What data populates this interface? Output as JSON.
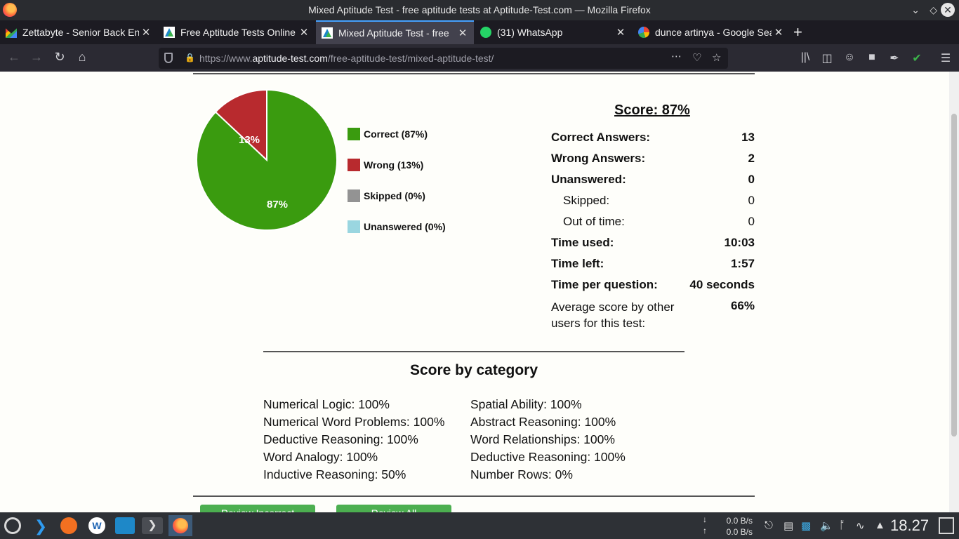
{
  "window": {
    "title": "Mixed Aptitude Test - free aptitude tests at Aptitude-Test.com — Mozilla Firefox"
  },
  "tabs": [
    {
      "label": "Zettabyte - Senior Back En",
      "icon": "gmail-icon"
    },
    {
      "label": "Free Aptitude Tests Online",
      "icon": "aptitude-test-icon"
    },
    {
      "label": "Mixed Aptitude Test - free",
      "icon": "aptitude-test-icon",
      "active": true
    },
    {
      "label": "(31) WhatsApp",
      "icon": "whatsapp-icon"
    },
    {
      "label": "dunce artinya - Google Sea",
      "icon": "google-icon"
    }
  ],
  "nav": {
    "url_prefix": "https://www.",
    "url_host": "aptitude-test.com",
    "url_path": "/free-aptitude-test/mixed-aptitude-test/"
  },
  "pie": {
    "correct_label": "87%",
    "wrong_label": "13%",
    "correct_fraction": 0.87,
    "wrong_fraction": 0.13
  },
  "legend": [
    {
      "label": "Correct (87%)",
      "color": "#3a9b0f"
    },
    {
      "label": "Wrong (13%)",
      "color": "#b82a2e"
    },
    {
      "label": "Skipped (0%)",
      "color": "#939393"
    },
    {
      "label": "Unanswered (0%)",
      "color": "#9ad6e0"
    }
  ],
  "score": {
    "title": "Score: 87%",
    "rows": [
      {
        "label": "Correct Answers:",
        "value": "13"
      },
      {
        "label": "Wrong Answers:",
        "value": "2"
      },
      {
        "label": "Unanswered:",
        "value": "0"
      },
      {
        "label": "Skipped:",
        "value": "0"
      },
      {
        "label": "Out of time:",
        "value": "0"
      },
      {
        "label": "Time used:",
        "value": "10:03"
      },
      {
        "label": "Time left:",
        "value": "1:57"
      },
      {
        "label": "Time per question:",
        "value": "40 seconds"
      }
    ],
    "average_label_line1": "Average score by other",
    "average_label_line2": "users for this test:",
    "average_value": "66%"
  },
  "categories": {
    "title": "Score by category",
    "left": [
      "Numerical Logic: 100%",
      "Numerical Word Problems: 100%",
      "Deductive Reasoning: 100%",
      "Word Analogy: 100%",
      "Inductive Reasoning: 50%"
    ],
    "right": [
      "Spatial Ability: 100%",
      "Abstract Reasoning: 100%",
      "Word Relationships: 100%",
      "Deductive Reasoning: 100%",
      "Number Rows: 0%"
    ]
  },
  "buttons": {
    "review_incorrect": "Review Incorrect",
    "review_all": "Review All"
  },
  "taskbar": {
    "net_down": "0.0 B/s",
    "net_up": "0.0 B/s",
    "clock": "18.27"
  }
}
